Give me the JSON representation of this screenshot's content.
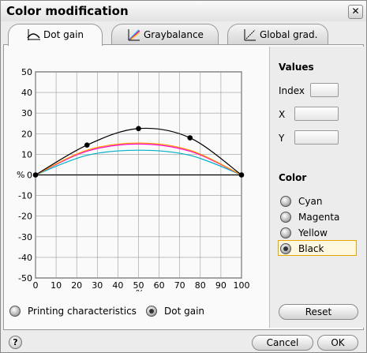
{
  "window": {
    "title": "Color modification",
    "close_symbol": "✕"
  },
  "tabs": [
    {
      "label": "Dot gain",
      "icon": "dot-gain-icon",
      "active": true
    },
    {
      "label": "Graybalance",
      "icon": "graybalance-icon",
      "active": false
    },
    {
      "label": "Global grad.",
      "icon": "global-grad-icon",
      "active": false
    }
  ],
  "values_panel": {
    "heading": "Values",
    "index_label": "Index",
    "index_value": "",
    "x_label": "X",
    "x_value": "",
    "y_label": "Y",
    "y_value": ""
  },
  "color_panel": {
    "heading": "Color",
    "options": [
      "Cyan",
      "Magenta",
      "Yellow",
      "Black"
    ],
    "selected": "Black"
  },
  "mode": {
    "options": [
      "Printing characteristics",
      "Dot gain"
    ],
    "selected": "Dot gain"
  },
  "buttons": {
    "reset": "Reset",
    "cancel": "Cancel",
    "ok": "OK",
    "help": "?"
  },
  "chart_data": {
    "type": "line",
    "xlabel": "%",
    "ylabel": "%",
    "xlim": [
      0,
      100
    ],
    "ylim": [
      -50,
      50
    ],
    "x_ticks": [
      0,
      10,
      20,
      30,
      40,
      50,
      60,
      70,
      80,
      90,
      100
    ],
    "y_ticks": [
      50,
      40,
      30,
      20,
      10,
      0,
      -10,
      -20,
      -30,
      -40,
      -50
    ],
    "grid": true,
    "series": [
      {
        "name": "Black",
        "color": "#000000",
        "x": [
          0,
          25,
          50,
          75,
          100
        ],
        "y": [
          0,
          14.5,
          22.5,
          18,
          0
        ],
        "control_points": true
      },
      {
        "name": "Yellow",
        "color": "#ff9900",
        "x": [
          0,
          25,
          50,
          75,
          100
        ],
        "y": [
          0,
          12,
          15.5,
          12,
          0
        ]
      },
      {
        "name": "Magenta",
        "color": "#ff00cc",
        "x": [
          0,
          25,
          50,
          75,
          100
        ],
        "y": [
          0,
          11.5,
          15,
          11.5,
          0
        ]
      },
      {
        "name": "Cyan",
        "color": "#00b0c8",
        "x": [
          0,
          25,
          50,
          75,
          100
        ],
        "y": [
          0,
          9.5,
          12,
          9.5,
          0
        ]
      }
    ]
  }
}
